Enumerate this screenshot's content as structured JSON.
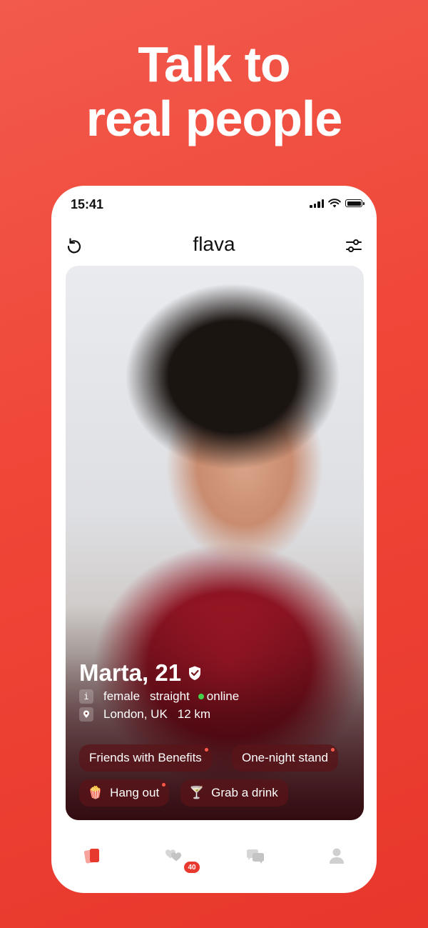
{
  "headline": {
    "line1": "Talk to",
    "line2": "real people"
  },
  "status_bar": {
    "time": "15:41"
  },
  "app": {
    "title": "flava"
  },
  "profile": {
    "name": "Marta, 21",
    "info_icon": "i",
    "gender": "female",
    "orientation": "straight",
    "status": "online",
    "location": "London, UK",
    "distance": "12 km"
  },
  "tags": [
    {
      "label": "Friends with Benefits"
    },
    {
      "label": "One-night stand"
    },
    {
      "label": "Hang out",
      "emoji": "🍿"
    },
    {
      "label": "Grab a drink",
      "emoji": "🍸"
    }
  ],
  "tabbar": {
    "likes_badge": "40"
  },
  "colors": {
    "brand": "#ef4638",
    "online": "#45d04a",
    "badge": "#e8392f"
  },
  "icons": [
    "undo-icon",
    "filter-sliders-icon",
    "verified-badge-icon",
    "location-pin-icon",
    "cards-icon",
    "hearts-icon",
    "chat-bubbles-icon",
    "profile-icon"
  ]
}
